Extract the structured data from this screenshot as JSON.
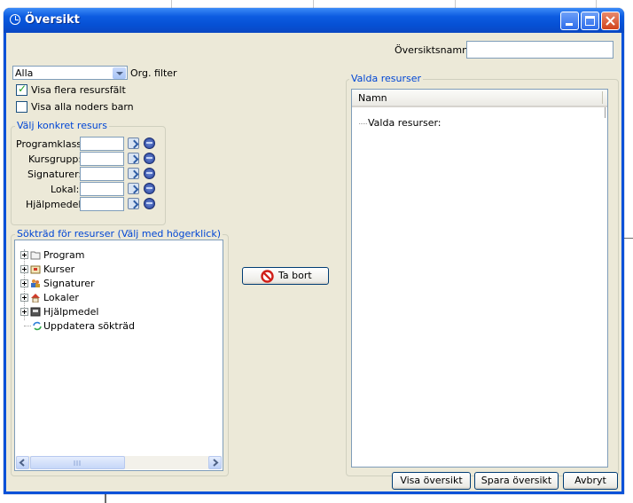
{
  "window": {
    "title": "Översikt"
  },
  "header": {
    "name_label": "Översiktsnamn:",
    "name_value": ""
  },
  "filter": {
    "selected": "Alla",
    "label": "Org. filter"
  },
  "options": {
    "show_multiple": {
      "label": "Visa flera resursfält",
      "checked": true
    },
    "show_all_children": {
      "label": "Visa alla noders barn",
      "checked": false
    }
  },
  "specific": {
    "legend": "Välj konkret resurs",
    "fields": [
      {
        "label": "Programklass:",
        "value": ""
      },
      {
        "label": "Kursgrupp:",
        "value": ""
      },
      {
        "label": "Signaturer:",
        "value": ""
      },
      {
        "label": "Lokal:",
        "value": ""
      },
      {
        "label": "Hjälpmedel:",
        "value": ""
      }
    ]
  },
  "search_tree": {
    "legend": "Sökträd för resurser (Välj med högerklick)",
    "items": [
      {
        "label": "Program",
        "icon": "folder-icon"
      },
      {
        "label": "Kurser",
        "icon": "course-icon"
      },
      {
        "label": "Signaturer",
        "icon": "users-icon"
      },
      {
        "label": "Lokaler",
        "icon": "house-icon"
      },
      {
        "label": "Hjälpmedel",
        "icon": "equipment-icon"
      },
      {
        "label": "Uppdatera sökträd",
        "icon": "refresh-icon"
      }
    ]
  },
  "remove_button": {
    "label": "Ta bort",
    "icon": "no-entry-icon"
  },
  "selected": {
    "legend": "Valda resurser",
    "column": "Namn",
    "root": "Valda resurser:"
  },
  "footer": {
    "show": "Visa översikt",
    "save": "Spara översikt",
    "cancel": "Avbryt"
  },
  "colors": {
    "titlebar": "#0a51d8",
    "dialog_bg": "#ece9d8",
    "legend": "#0046d5"
  }
}
